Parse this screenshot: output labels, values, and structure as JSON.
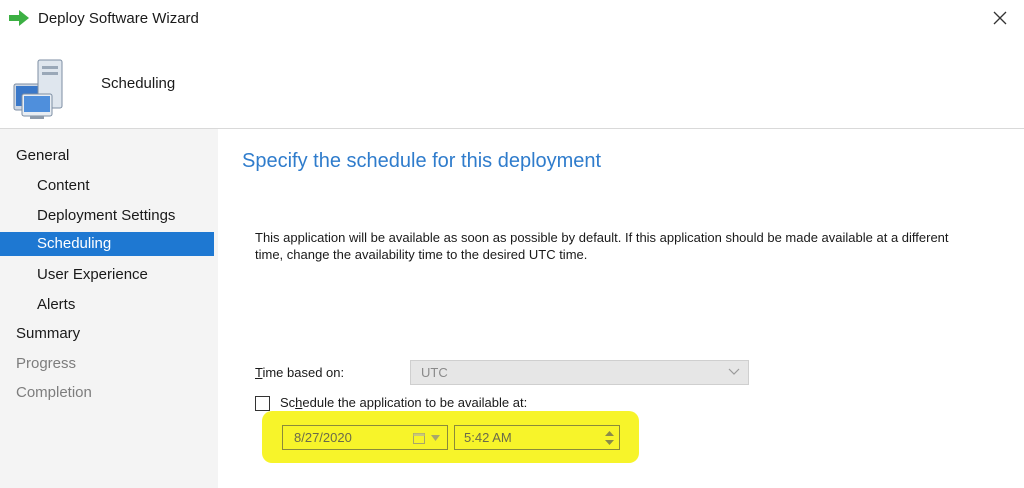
{
  "window": {
    "title": "Deploy Software Wizard",
    "close_icon": "close-icon"
  },
  "header": {
    "title": "Scheduling",
    "icon": "computer-icon"
  },
  "nav": {
    "items": [
      {
        "label": "General",
        "level": "top",
        "state": "normal"
      },
      {
        "label": "Content",
        "level": "sub",
        "state": "normal"
      },
      {
        "label": "Deployment Settings",
        "level": "sub",
        "state": "normal"
      },
      {
        "label": "Scheduling",
        "level": "sub",
        "state": "active"
      },
      {
        "label": "User Experience",
        "level": "sub",
        "state": "normal"
      },
      {
        "label": "Alerts",
        "level": "sub",
        "state": "normal"
      },
      {
        "label": "Summary",
        "level": "top",
        "state": "normal"
      },
      {
        "label": "Progress",
        "level": "top",
        "state": "disabled"
      },
      {
        "label": "Completion",
        "level": "top",
        "state": "disabled"
      }
    ]
  },
  "main": {
    "heading": "Specify the schedule for this deployment",
    "description": "This application will be available as soon as possible by default. If this application should be made available at a different time, change the availability time to the desired UTC time.",
    "time_based_on": {
      "label_accel": "T",
      "label_rest": "ime based on:",
      "value": "UTC"
    },
    "schedule_checkbox": {
      "checked": false,
      "label_pre": "Sc",
      "label_accel": "h",
      "label_rest": "edule the application to be available at:"
    },
    "date": {
      "value": "8/27/2020"
    },
    "time": {
      "value": "5:42 AM"
    }
  },
  "colors": {
    "accent": "#1e78d2",
    "heading": "#2f7ccc",
    "highlight": "#f7f42a"
  }
}
